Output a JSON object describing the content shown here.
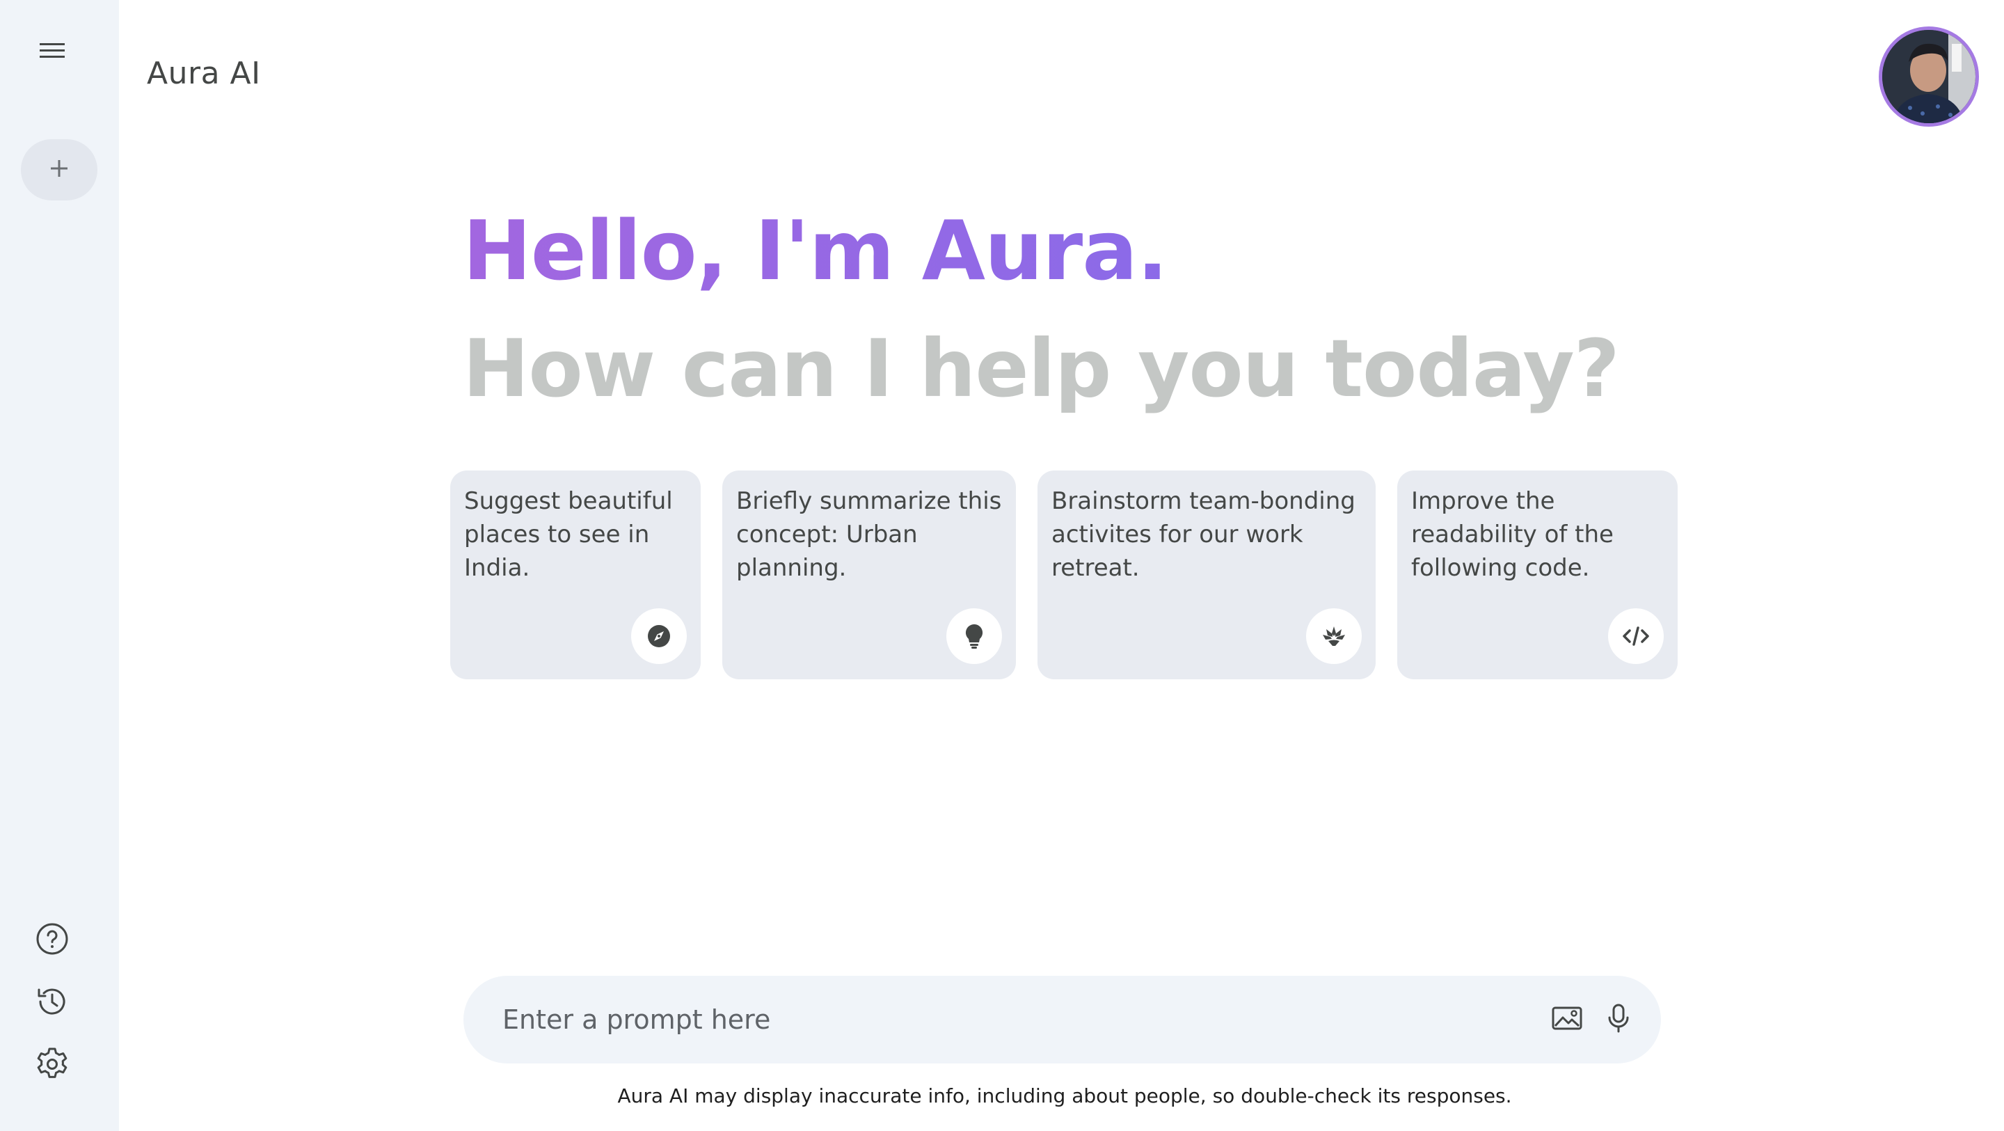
{
  "app": {
    "title": "Aura AI"
  },
  "greeting": {
    "title": "Hello, I'm Aura.",
    "subtitle": "How can I help you today?"
  },
  "suggestions": [
    {
      "text": "Suggest beautiful places to see in India.",
      "icon": "compass-icon"
    },
    {
      "text": "Briefly summarize this concept: Urban planning.",
      "icon": "lightbulb-icon"
    },
    {
      "text": "Brainstorm team-bonding activites for our work retreat.",
      "icon": "lotus-icon"
    },
    {
      "text": "Improve the readability of the following code.",
      "icon": "code-icon"
    }
  ],
  "prompt": {
    "placeholder": "Enter a prompt here"
  },
  "footer": {
    "disclaimer": "Aura AI may display inaccurate info, including about people, so double-check its responses."
  },
  "colors": {
    "accent_start": "#a267e0",
    "accent_end": "#8b6ae8",
    "sidebar_bg": "#f0f4f9",
    "card_bg": "#e8ebf1"
  }
}
